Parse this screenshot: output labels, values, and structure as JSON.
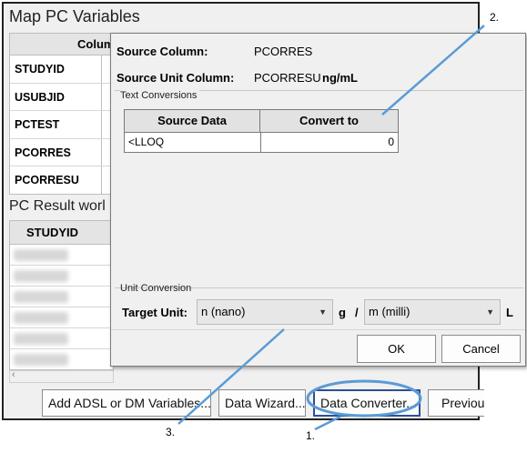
{
  "main_window": {
    "title": "Map PC Variables",
    "map_table": {
      "header": "Colum",
      "rows": [
        "STUDYID",
        "USUBJID",
        "PCTEST",
        "PCORRES",
        "PCORRESU"
      ]
    },
    "result_title": "PC Result worl",
    "result_table": {
      "header": "STUDYID",
      "row_count": 6
    },
    "buttons": {
      "add_variables": "Add ADSL or DM Variables...",
      "data_wizard": "Data Wizard...",
      "data_converter": "Data Converter...",
      "previous": "Previou"
    }
  },
  "dialog": {
    "source_column_label": "Source Column:",
    "source_column_value": "PCORRES",
    "source_unit_label": "Source Unit Column:",
    "source_unit_value": "PCORRESU",
    "source_unit_unit": "ng/mL",
    "text_conversions_title": "Text Conversions",
    "table": {
      "headers": [
        "Source Data",
        "Convert to"
      ],
      "rows": [
        {
          "source": "<LLOQ",
          "convert": "0"
        }
      ]
    },
    "unit_conversion_title": "Unit Conversion",
    "target_unit_label": "Target Unit:",
    "prefix_value": "n (nano)",
    "g_label": "g",
    "slash_label": "/",
    "milli_value": "m (milli)",
    "l_label": "L",
    "ok_label": "OK",
    "cancel_label": "Cancel"
  },
  "callouts": {
    "one": "1.",
    "two": "2.",
    "three": "3."
  },
  "colors": {
    "callout": "#5b9bd5",
    "highlight_border": "#2b4f9a"
  }
}
